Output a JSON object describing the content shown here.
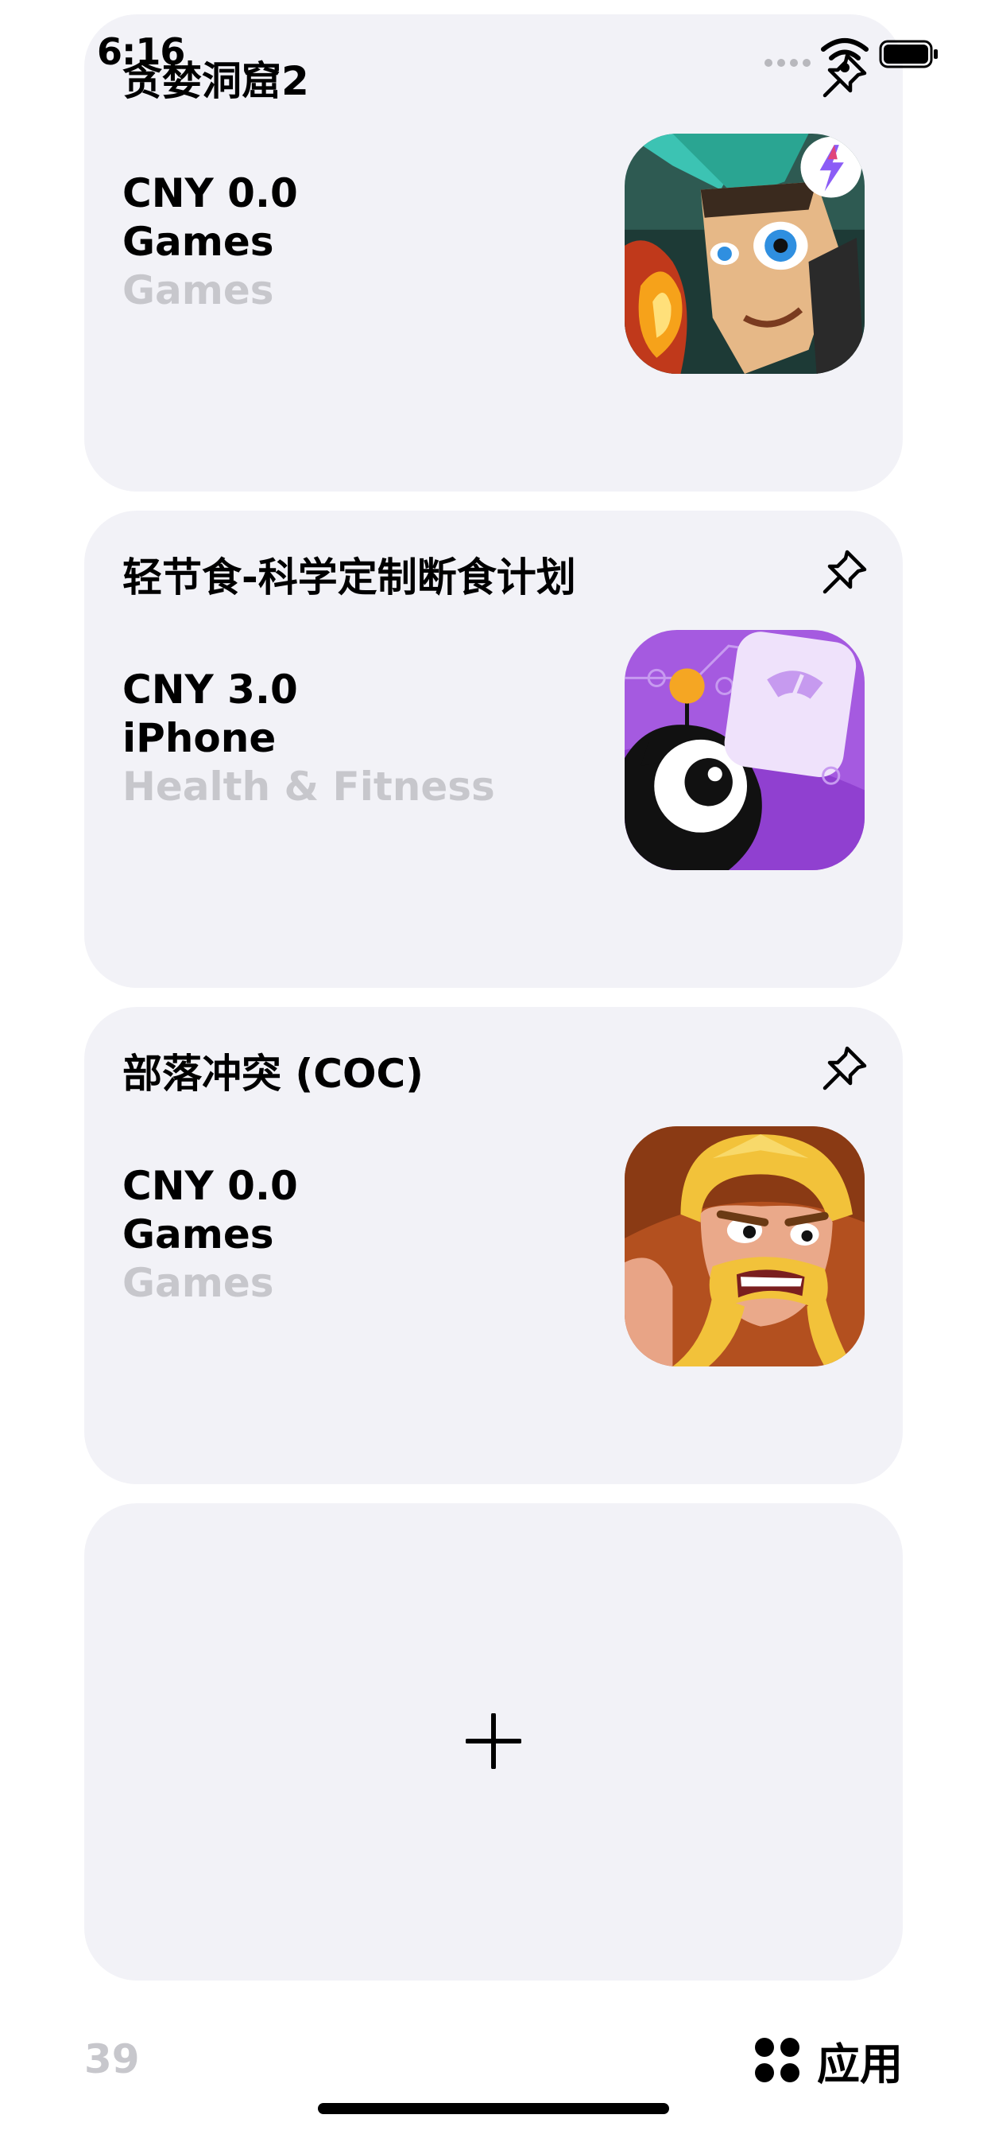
{
  "status_bar": {
    "time": "6:16"
  },
  "cards": [
    {
      "title": "贪婪洞窟2",
      "price": "CNY 0.0",
      "device": "Games",
      "genre": "Games",
      "icon": "hero-character-app-icon"
    },
    {
      "title": "轻节食-科学定制断食计划",
      "price": "CNY 3.0",
      "device": "iPhone",
      "genre": "Health & Fitness",
      "icon": "scale-monster-app-icon"
    },
    {
      "title": "部落冲突 (COC)",
      "price": "CNY 0.0",
      "device": "Games",
      "genre": "Games",
      "icon": "barbarian-app-icon"
    }
  ],
  "add_card": {
    "icon": "plus-icon"
  },
  "footer": {
    "count": "39",
    "apps_label": "应用"
  },
  "colors": {
    "card_bg": "#f2f2f7",
    "secondary_text": "#c7c7cc"
  }
}
